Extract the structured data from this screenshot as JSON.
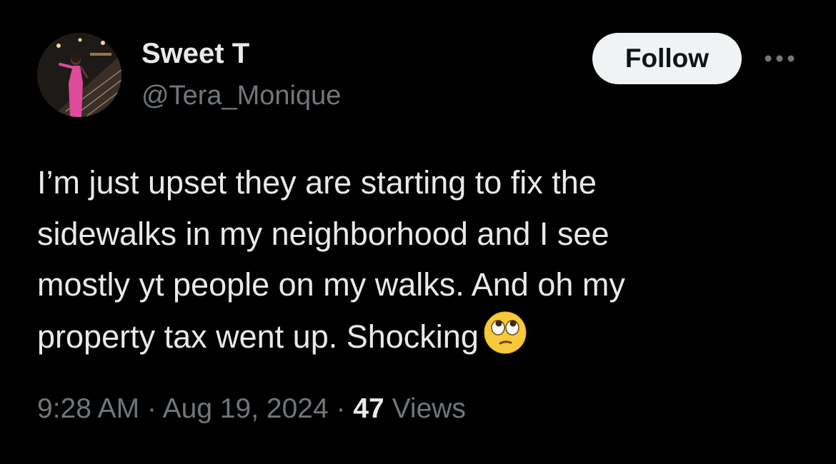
{
  "author": {
    "display_name": "Sweet T",
    "handle": "@Tera_Monique"
  },
  "actions": {
    "follow_label": "Follow",
    "more_icon": "more-horizontal-icon"
  },
  "tweet": {
    "lines": [
      "I’m just upset they are starting to fix the",
      "sidewalks in my neighborhood and I see",
      "mostly yt people on my walks. And oh my",
      "property tax went up. Shocking"
    ],
    "emoji": "face-with-rolling-eyes-icon"
  },
  "meta": {
    "time": "9:28 AM",
    "separator": "·",
    "date": "Aug 19, 2024",
    "views_count": "47",
    "views_label": "Views"
  },
  "colors": {
    "background": "#000000",
    "primary_text": "#e7e9ea",
    "secondary_text": "#71767b",
    "follow_button_bg": "#eff3f4",
    "follow_button_text": "#0f1419"
  }
}
